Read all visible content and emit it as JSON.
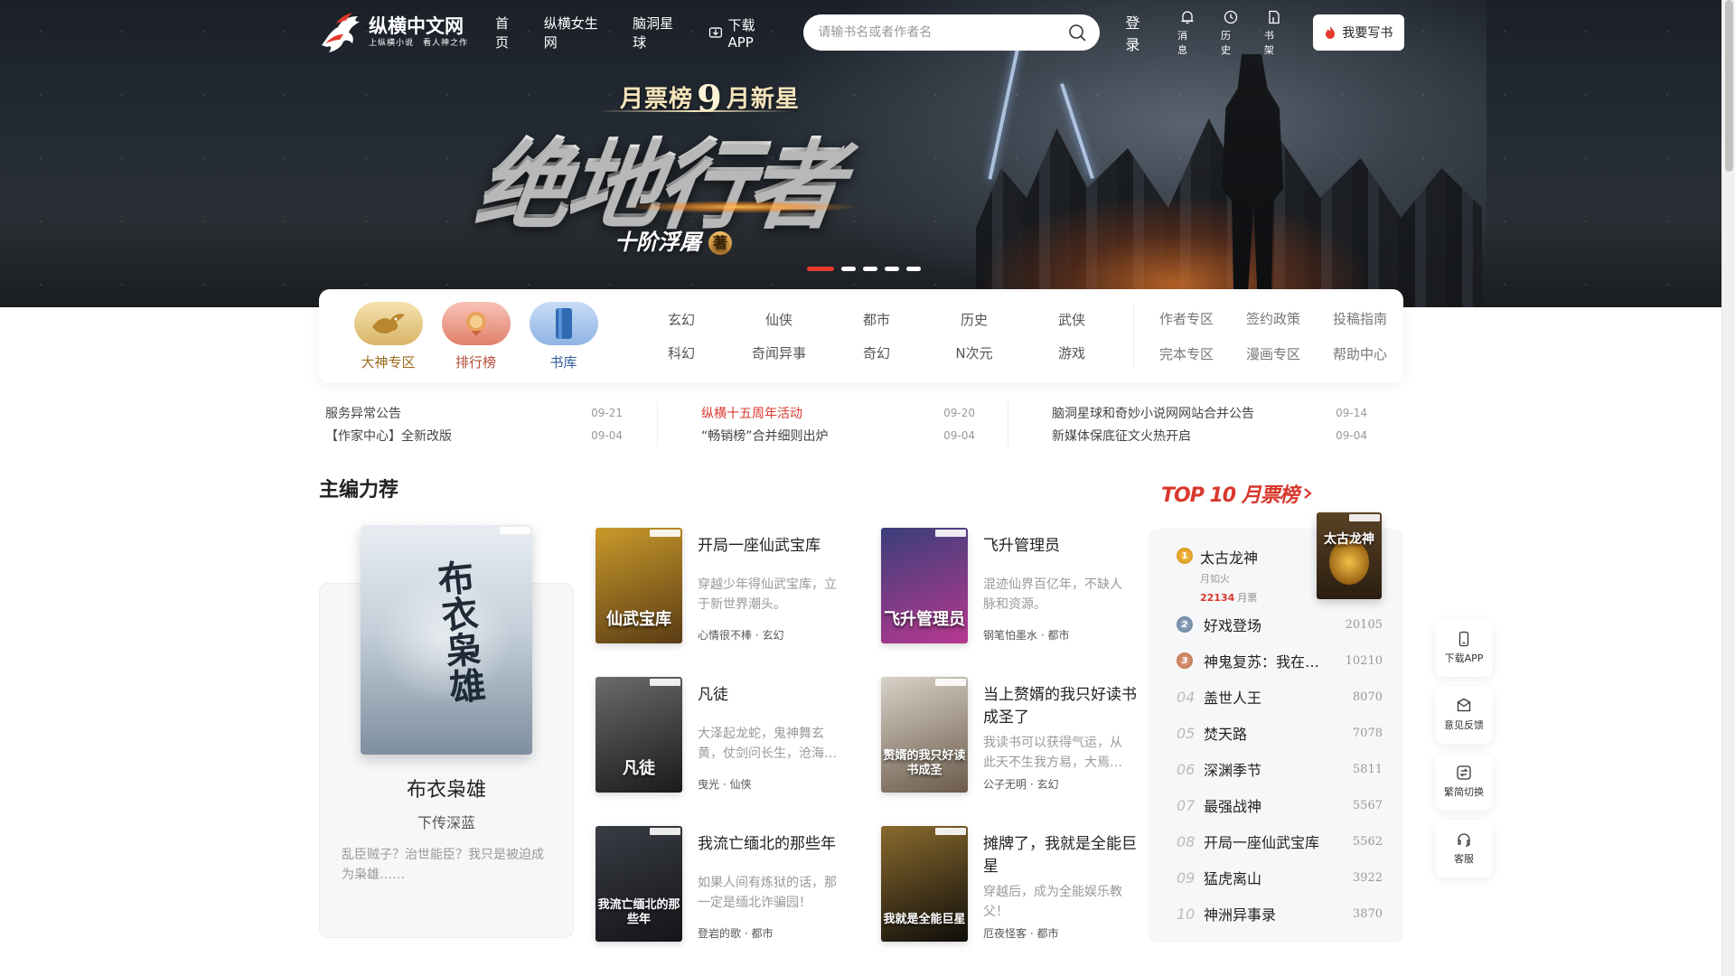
{
  "header": {
    "logo_title": "纵横中文网",
    "logo_slogan": "上纵横小说　看人神之作",
    "nav": [
      {
        "label": "首页"
      },
      {
        "label": "纵横女生网"
      },
      {
        "label": "脑洞星球"
      },
      {
        "label": "下载APP"
      }
    ],
    "search_placeholder": "请输书名或者作者名",
    "login_label": "登录",
    "icons": [
      {
        "label": "消息",
        "icon": "bell-icon"
      },
      {
        "label": "历史",
        "icon": "clock-icon"
      },
      {
        "label": "书架",
        "icon": "bookshelf-icon"
      }
    ],
    "write_label": "我要写书"
  },
  "banner": {
    "subtitle_pre": "月票榜",
    "subtitle_num": "9",
    "subtitle_post": "月新星",
    "title": "绝地行者",
    "author": "十阶浮屠",
    "author_suffix": "著",
    "dots_total": 5,
    "dots_active": 1
  },
  "categories": {
    "big": [
      {
        "label": "大神专区",
        "color": "#9a6a1d"
      },
      {
        "label": "排行榜",
        "color": "#b44a36"
      },
      {
        "label": "书库",
        "color": "#2f5d9a"
      }
    ],
    "genres": [
      "玄幻",
      "仙侠",
      "都市",
      "历史",
      "武侠",
      "科幻",
      "奇闻异事",
      "奇幻",
      "N次元",
      "游戏"
    ],
    "links": [
      "作者专区",
      "签约政策",
      "投稿指南",
      "完本专区",
      "漫画专区",
      "帮助中心"
    ]
  },
  "notices": [
    [
      {
        "title": "服务异常公告",
        "date": "09-21",
        "red": false
      },
      {
        "title": "【作家中心】全新改版",
        "date": "09-04",
        "red": false
      }
    ],
    [
      {
        "title": "纵横十五周年活动",
        "date": "09-20",
        "red": true
      },
      {
        "title": "“畅销榜”合并细则出炉",
        "date": "09-04",
        "red": false
      }
    ],
    [
      {
        "title": "脑洞星球和奇妙小说网网站合并公告",
        "date": "09-14",
        "red": false
      },
      {
        "title": "新媒体保底征文火热开启",
        "date": "09-04",
        "red": false
      }
    ]
  ],
  "editor": {
    "title": "主编力荐",
    "feature": {
      "name": "布衣枭雄",
      "author": "下传深蓝",
      "desc": "乱臣贼子？治世能臣？我只是被迫成为枭雄……",
      "cover_text": "布衣枭雄"
    },
    "books": [
      {
        "title": "开局一座仙武宝库",
        "desc": "穿越少年得仙武宝库，立于新世界潮头。",
        "author": "心情很不棒",
        "genre": "玄幻",
        "cover_text": "仙武宝库",
        "c1": "#c99a2b",
        "c2": "#5a3b14"
      },
      {
        "title": "飞升管理员",
        "desc": "混迹仙界百亿年，不缺人脉和资源。",
        "author": "钢笔怕墨水",
        "genre": "都市",
        "cover_text": "飞升管理员",
        "c1": "#3a3f7a",
        "c2": "#b7388f"
      },
      {
        "title": "凡徒",
        "desc": "大泽起龙蛇，鬼神舞玄黄，仗剑问长生，沧海…",
        "author": "曳光",
        "genre": "仙侠",
        "cover_text": "凡徒",
        "c1": "#6b6b6b",
        "c2": "#1a1a1a"
      },
      {
        "title": "当上赘婿的我只好读书成圣了",
        "desc": "我读书可以获得气运，从此天不生我方易，大焉…",
        "author": "公子无明",
        "genre": "玄幻",
        "cover_text": "赘婿的我只好读书成圣",
        "c1": "#d8d2c8",
        "c2": "#6b5a4a"
      },
      {
        "title": "我流亡缅北的那些年",
        "desc": "如果人间有炼狱的话，那一定是缅北诈骗园！",
        "author": "登岩的歌",
        "genre": "都市",
        "cover_text": "我流亡缅北的那些年",
        "c1": "#3a3c44",
        "c2": "#14151a"
      },
      {
        "title": "摊牌了，我就是全能巨星",
        "desc": "穿越后，成为全能娱乐教父！",
        "author": "厄夜怪客",
        "genre": "都市",
        "cover_text": "我就是全能巨星",
        "c1": "#8a6a2e",
        "c2": "#0f0d0a"
      }
    ]
  },
  "ranking": {
    "title": "TOP 10 月票榜",
    "top": {
      "rank": "1",
      "name": "太古龙神",
      "author": "月如火",
      "votes": "22134",
      "votes_unit": "月票",
      "cover_text": "太古龙神"
    },
    "rows": [
      {
        "rank": "2",
        "name": "好戏登场",
        "votes": "20105",
        "medal": true
      },
      {
        "rank": "3",
        "name": "神鬼复苏：我在…",
        "votes": "10210",
        "medal": true
      },
      {
        "rank": "04",
        "name": "盖世人王",
        "votes": "8070",
        "medal": false
      },
      {
        "rank": "05",
        "name": "焚天路",
        "votes": "7078",
        "medal": false
      },
      {
        "rank": "06",
        "name": "深渊季节",
        "votes": "5811",
        "medal": false
      },
      {
        "rank": "07",
        "name": "最强战神",
        "votes": "5567",
        "medal": false
      },
      {
        "rank": "08",
        "name": "开局一座仙武宝库",
        "votes": "5562",
        "medal": false
      },
      {
        "rank": "09",
        "name": "猛虎离山",
        "votes": "3922",
        "medal": false
      },
      {
        "rank": "10",
        "name": "神洲异事录",
        "votes": "3870",
        "medal": false
      }
    ]
  },
  "sidebar": [
    {
      "label": "下载APP",
      "icon": "phone-icon"
    },
    {
      "label": "意见反馈",
      "icon": "feedback-icon"
    },
    {
      "label": "繁简切换",
      "icon": "translate-icon"
    },
    {
      "label": "客服",
      "icon": "headset-icon"
    }
  ]
}
